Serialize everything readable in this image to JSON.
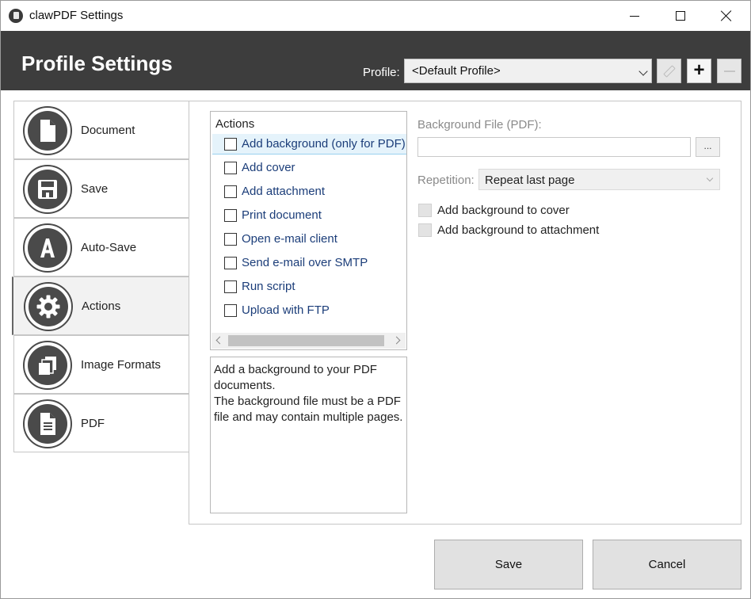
{
  "window": {
    "title": "clawPDF Settings"
  },
  "header": {
    "title": "Profile Settings",
    "profile_label": "Profile:",
    "profile_value": "<Default Profile>"
  },
  "nav": {
    "items": [
      {
        "label": "Document",
        "icon": "document-icon",
        "active": false
      },
      {
        "label": "Save",
        "icon": "floppy-disk-icon",
        "active": false
      },
      {
        "label": "Auto-Save",
        "icon": "auto-save-a-icon",
        "active": false
      },
      {
        "label": "Actions",
        "icon": "gear-icon",
        "active": true
      },
      {
        "label": "Image Formats",
        "icon": "image-formats-icon",
        "active": false
      },
      {
        "label": "PDF",
        "icon": "pdf-document-icon",
        "active": false
      }
    ]
  },
  "actions": {
    "header": "Actions",
    "items": [
      {
        "label": "Add background (only for PDF)",
        "checked": false,
        "selected": true
      },
      {
        "label": "Add cover",
        "checked": false,
        "selected": false
      },
      {
        "label": "Add attachment",
        "checked": false,
        "selected": false
      },
      {
        "label": "Print document",
        "checked": false,
        "selected": false
      },
      {
        "label": "Open e-mail client",
        "checked": false,
        "selected": false
      },
      {
        "label": "Send e-mail over SMTP",
        "checked": false,
        "selected": false
      },
      {
        "label": "Run script",
        "checked": false,
        "selected": false
      },
      {
        "label": "Upload with FTP",
        "checked": false,
        "selected": false
      }
    ],
    "description": "Add a background to your PDF documents.\nThe background file must be a PDF file and may contain multiple pages."
  },
  "background": {
    "file_label": "Background File (PDF):",
    "file_value": "",
    "browse_label": "...",
    "repetition_label": "Repetition:",
    "repetition_value": "Repeat last page",
    "option_cover": "Add background to cover",
    "option_attachment": "Add background to attachment"
  },
  "footer": {
    "save_label": "Save",
    "cancel_label": "Cancel"
  }
}
